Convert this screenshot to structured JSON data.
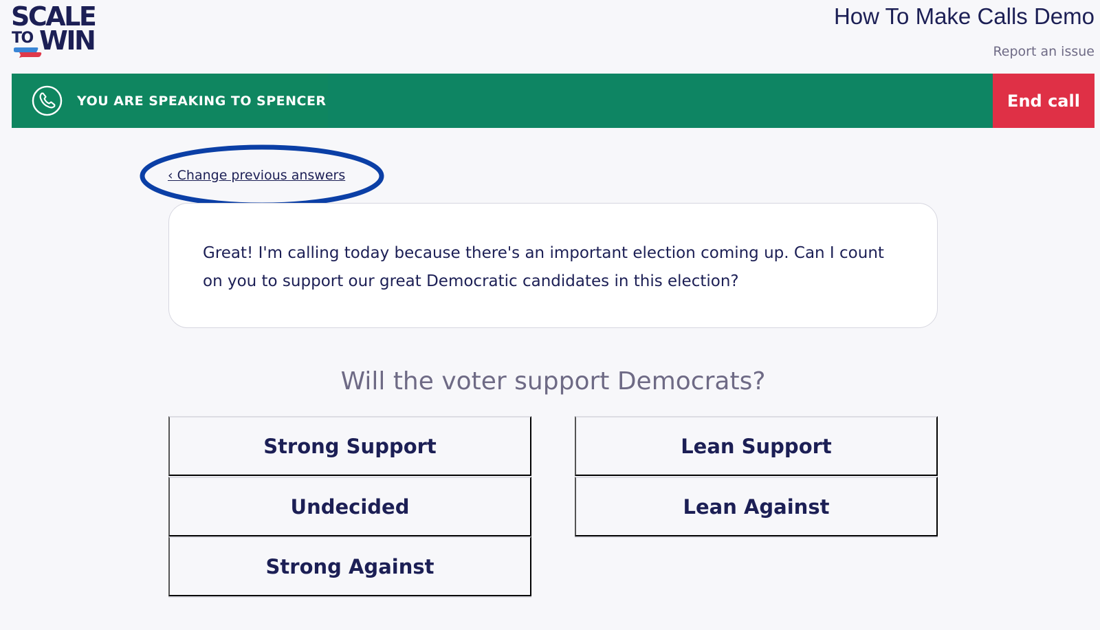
{
  "brand": {
    "logo_line1": "SCALE",
    "logo_to": "TO",
    "logo_win": "WIN",
    "accent_blue": "#3a86d6",
    "accent_red": "#e0394a"
  },
  "header": {
    "title": "How To Make Calls Demo",
    "report_link": "Report an issue"
  },
  "call_bar": {
    "icon": "phone-icon",
    "lead_text": "YOU ARE SPEAKING TO",
    "contact_name": "SPENCER",
    "end_call_label": "End call",
    "bar_color": "#0e8563",
    "end_call_color": "#df3046"
  },
  "navigation": {
    "change_previous_label": "‹ Change previous answers",
    "highlight_color": "#0b3fa6"
  },
  "script": {
    "text": "Great! I'm calling today because there's an important election coming up. Can I count on you to support our great Democratic candidates in this election?"
  },
  "question": {
    "text": "Will the voter support Democrats?",
    "options": [
      "Strong Support",
      "Lean Support",
      "Undecided",
      "Lean Against",
      "Strong Against"
    ]
  }
}
